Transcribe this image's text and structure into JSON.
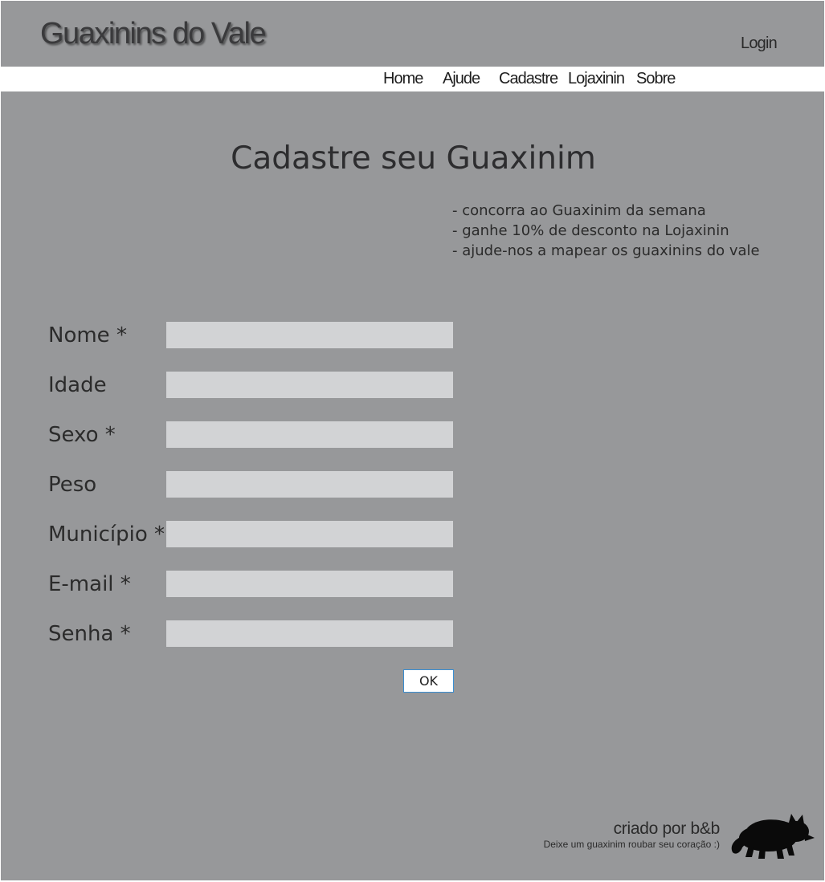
{
  "header": {
    "site_title": "Guaxinins do Vale",
    "login_label": "Login"
  },
  "nav": {
    "items": [
      {
        "label": "Home"
      },
      {
        "label": "Ajude"
      },
      {
        "label": "Cadastre"
      },
      {
        "label": "Lojaxinin"
      },
      {
        "label": "Sobre"
      }
    ]
  },
  "main": {
    "heading": "Cadastre seu Guaxinim",
    "benefits": [
      "- concorra ao Guaxinim da semana",
      "- ganhe 10% de desconto na Lojaxinin",
      "- ajude-nos a mapear os guaxinins do vale"
    ]
  },
  "form": {
    "fields": [
      {
        "label": "Nome *",
        "value": ""
      },
      {
        "label": "Idade",
        "value": ""
      },
      {
        "label": "Sexo *",
        "value": ""
      },
      {
        "label": "Peso",
        "value": ""
      },
      {
        "label": "Município *",
        "value": ""
      },
      {
        "label": "E-mail *",
        "value": ""
      },
      {
        "label": "Senha *",
        "value": ""
      }
    ],
    "submit_label": "OK"
  },
  "footer": {
    "credit": "criado por b&b",
    "tagline": "Deixe um guaxinim roubar seu coração :)",
    "raccoon_icon": "raccoon-silhouette-icon"
  },
  "colors": {
    "page_background": "#97989a",
    "nav_background": "#ffffff",
    "input_background": "#d2d3d5",
    "button_border": "#3a8ed1"
  }
}
